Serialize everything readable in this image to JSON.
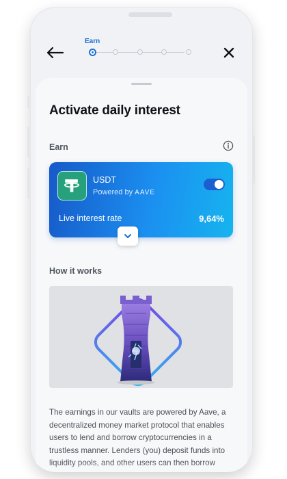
{
  "header": {
    "step_label": "Earn",
    "steps_total": 5,
    "active_step": 1
  },
  "page": {
    "title": "Activate daily interest",
    "section_earn": "Earn",
    "section_how": "How it works"
  },
  "asset_card": {
    "token": "USDT",
    "powered_by": "Powered by",
    "provider": "AAVE",
    "toggle_on": true,
    "rate_label": "Live interest rate",
    "rate_value": "9,64%"
  },
  "description": "The earnings in our vaults are powered by Aave, a decentralized money market protocol that enables users to lend and borrow cryptocurrencies in a trustless manner. Lenders (you) deposit funds into liquidity pools, and other users can then borrow",
  "colors": {
    "accent": "#1b6fd6",
    "card_start": "#1659c8",
    "card_end": "#16b4ef",
    "tether": "#26a17b"
  },
  "icons": {
    "back": "arrow-left-icon",
    "close": "close-icon",
    "info": "info-icon",
    "expand": "chevron-down-icon"
  }
}
